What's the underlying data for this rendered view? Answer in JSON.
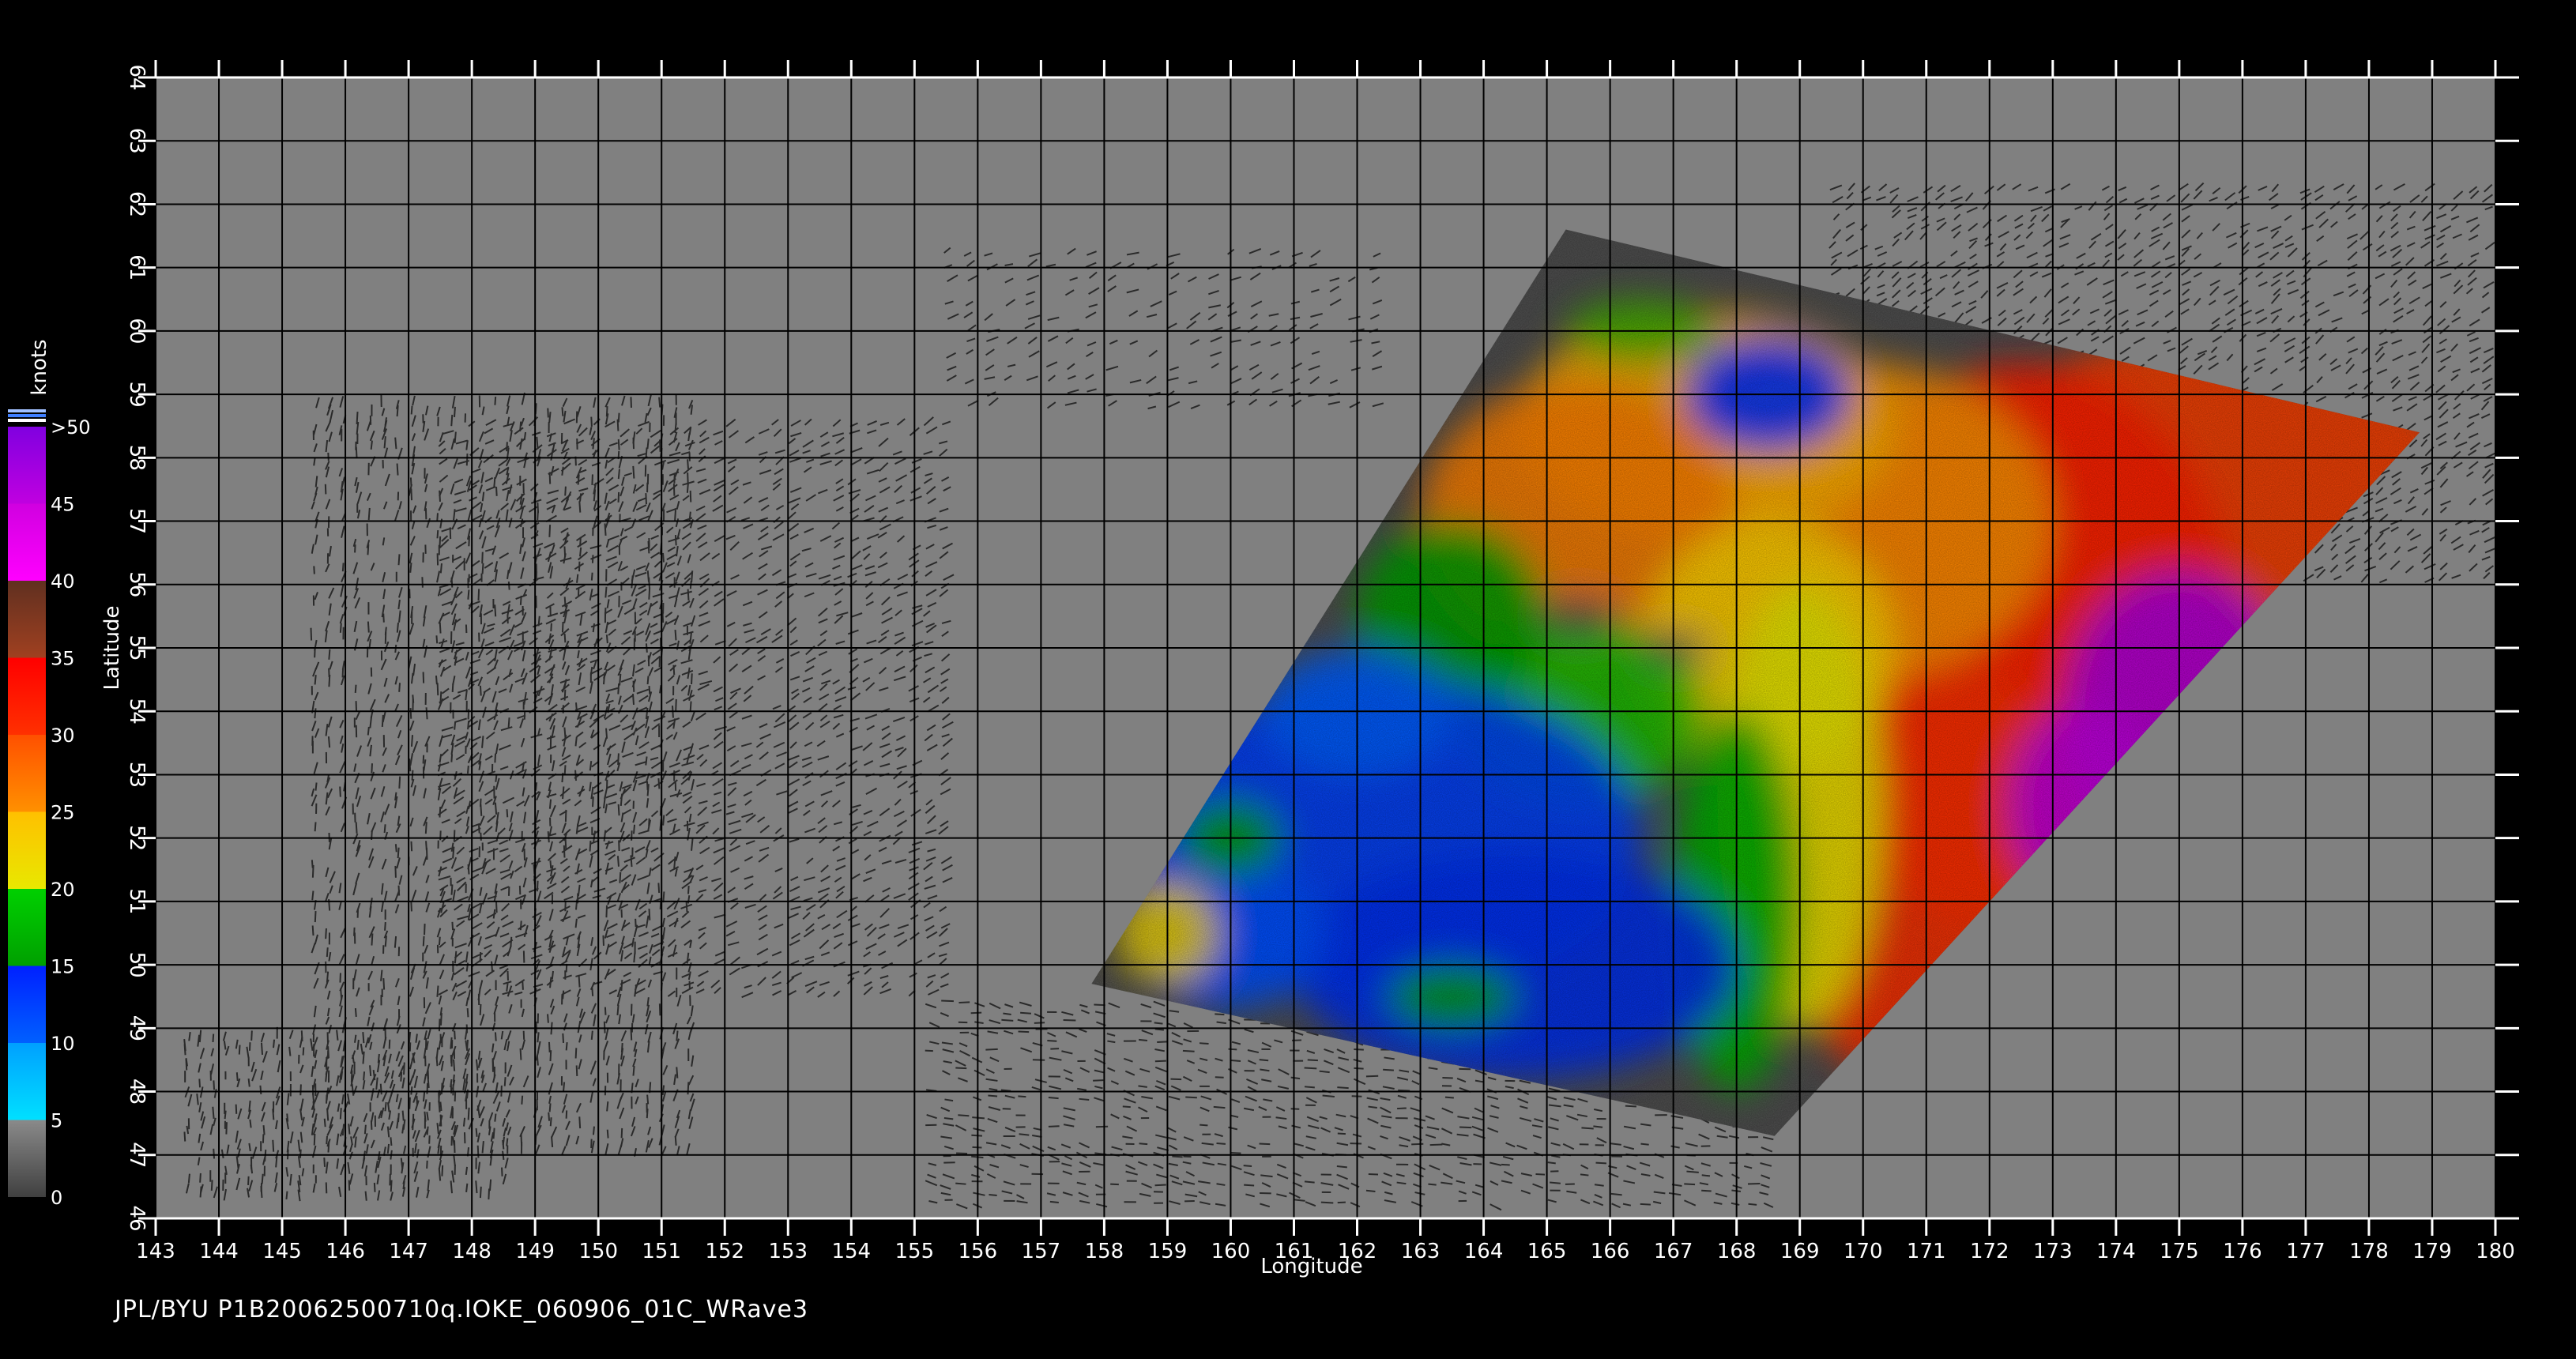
{
  "map": {
    "x_axis_label": "Longitude",
    "y_axis_label": "Latitude",
    "lon_ticks": [
      "143",
      "144",
      "145",
      "146",
      "147",
      "148",
      "149",
      "150",
      "151",
      "152",
      "153",
      "154",
      "155",
      "156",
      "157",
      "158",
      "159",
      "160",
      "161",
      "162",
      "163",
      "164",
      "165",
      "166",
      "167",
      "168",
      "169",
      "170",
      "171",
      "172",
      "173",
      "174",
      "175",
      "176",
      "177",
      "178",
      "179",
      "180"
    ],
    "lat_ticks": [
      "46",
      "47",
      "48",
      "49",
      "50",
      "51",
      "52",
      "53",
      "54",
      "55",
      "56",
      "57",
      "58",
      "59",
      "60",
      "61",
      "62",
      "63",
      "64"
    ],
    "lon_range": [
      143,
      180
    ],
    "lat_range": [
      46,
      64
    ],
    "background_color": "#808080",
    "grid_color": "#000000"
  },
  "legend": {
    "unit_label": "knots",
    "labels": [
      ">50",
      "45",
      "40",
      "35",
      "30",
      "25",
      "20",
      "15",
      "10",
      "5",
      "0"
    ],
    "bands": [
      {
        "from": 0,
        "to": 5,
        "colors": [
          "#404040",
          "#8a8a8a"
        ]
      },
      {
        "from": 5,
        "to": 10,
        "colors": [
          "#00e0ff",
          "#00a0ff"
        ]
      },
      {
        "from": 10,
        "to": 15,
        "colors": [
          "#0060ff",
          "#0020ff"
        ]
      },
      {
        "from": 15,
        "to": 20,
        "colors": [
          "#00a000",
          "#00d000"
        ]
      },
      {
        "from": 20,
        "to": 25,
        "colors": [
          "#e8e800",
          "#ffc000"
        ]
      },
      {
        "from": 25,
        "to": 30,
        "colors": [
          "#ff9000",
          "#ff5000"
        ]
      },
      {
        "from": 30,
        "to": 35,
        "colors": [
          "#ff3000",
          "#ff0000"
        ]
      },
      {
        "from": 35,
        "to": 40,
        "colors": [
          "#a04020",
          "#603020"
        ]
      },
      {
        "from": 40,
        "to": 45,
        "colors": [
          "#ff00ff",
          "#d000e0"
        ]
      },
      {
        "from": 45,
        "to": 50,
        "colors": [
          "#c000e0",
          "#8000e0"
        ]
      }
    ]
  },
  "swath": {
    "corners_lonlat": [
      [
        165.3,
        61.6
      ],
      [
        178.8,
        58.4
      ],
      [
        168.6,
        47.3
      ],
      [
        157.8,
        49.7
      ]
    ]
  },
  "footer": {
    "caption": "JPL/BYU  P1B20062500710q.IOKE_060906_01C_WRave3"
  }
}
